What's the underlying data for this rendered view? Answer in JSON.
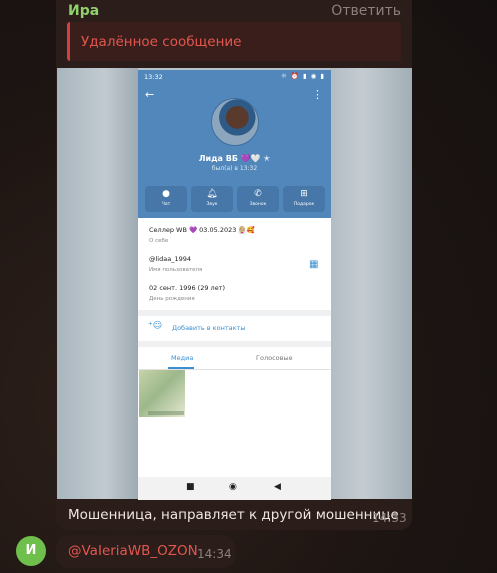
{
  "message1": {
    "sender": "Ира",
    "reply_label": "Ответить",
    "deleted_text": "Удалённое сообщение",
    "caption": "Мошенница, направляет к другой мошеннице",
    "time": "14:33"
  },
  "phone": {
    "status_time": "13:32",
    "status_icons": "☼ ⏰ ▮ ◉ ▮",
    "name": "Лида ВБ 💜🤍 ✭",
    "seen": "был(а) в 13:32",
    "actions": [
      {
        "icon": "chat-icon",
        "glyph": "●",
        "label": "Чат"
      },
      {
        "icon": "bell-icon",
        "glyph": "🔔︎",
        "label": "Звук"
      },
      {
        "icon": "phone-icon",
        "glyph": "✆",
        "label": "Звонок"
      },
      {
        "icon": "gift-icon",
        "glyph": "⊞",
        "label": "Подарок"
      }
    ],
    "bio": "Селлер WB 💜 03.05.2023 👰🏼🥰",
    "bio_label": "О себе",
    "username": "@lidaa_1994",
    "username_label": "Имя пользователя",
    "birthday": "02 сент. 1996 (29 лет)",
    "birthday_label": "День рождения",
    "add_contact": "Добавить в контакты",
    "tab_media": "Медиа",
    "tab_voice": "Голосовые"
  },
  "message2": {
    "avatar_letter": "И",
    "text": "@VaIeriaWB_OZON",
    "time": "14:34"
  },
  "colors": {
    "accent_green": "#8fd26c",
    "deleted_red": "#e2564f",
    "phone_header": "#5287bb",
    "link_blue": "#3b8fd0"
  }
}
